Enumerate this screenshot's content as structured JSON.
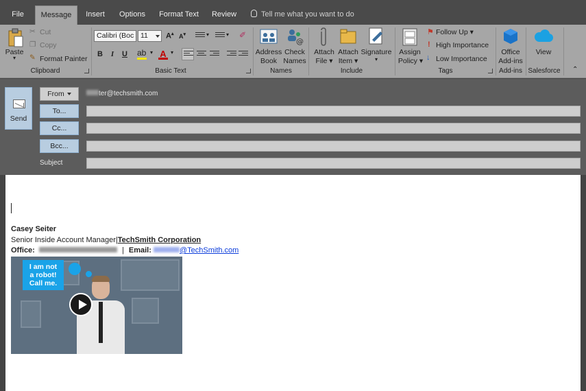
{
  "tabs": [
    "File",
    "Message",
    "Insert",
    "Options",
    "Format Text",
    "Review"
  ],
  "active_tab": "Message",
  "tell_me": "Tell me what you want to do",
  "ribbon": {
    "clipboard": {
      "paste": "Paste",
      "cut": "Cut",
      "copy": "Copy",
      "format_painter": "Format Painter",
      "label": "Clipboard"
    },
    "basic_text": {
      "font": "Calibri (Boc",
      "size": "11",
      "label": "Basic Text"
    },
    "names": {
      "address_book": [
        "Address",
        "Book"
      ],
      "check_names": [
        "Check",
        "Names"
      ],
      "label": "Names"
    },
    "include": {
      "attach_file": [
        "Attach",
        "File"
      ],
      "attach_item": [
        "Attach",
        "Item"
      ],
      "signature": "Signature",
      "label": "Include"
    },
    "tags": {
      "assign_policy": [
        "Assign",
        "Policy"
      ],
      "follow_up": "Follow Up",
      "high_importance": "High Importance",
      "low_importance": "Low Importance",
      "label": "Tags"
    },
    "addins": {
      "office_addins": [
        "Office",
        "Add-ins"
      ],
      "label": "Add-ins"
    },
    "salesforce": {
      "view": "View",
      "label": "Salesforce"
    }
  },
  "compose": {
    "send": "Send",
    "from_label": "From",
    "from_value": "ter@techsmith.com",
    "to_label": "To...",
    "cc_label": "Cc...",
    "bcc_label": "Bcc...",
    "subject_label": "Subject"
  },
  "signature": {
    "name": "Casey Seiter",
    "title": "Senior Inside Account Manager",
    "separator": "|",
    "company": "TechSmith Corporation",
    "office_label": "Office:",
    "pipe": "|",
    "email_label": "Email:",
    "email_domain": "@TechSmith.com",
    "video_bubble": [
      "I am not",
      "a robot!",
      "Call me."
    ]
  },
  "colors": {
    "tab_bar": "#4a4a4a",
    "ribbon": "#a6a6a6",
    "header_bg": "#5c5c5c",
    "field_button": "#b8cde0",
    "bubble": "#1aa3e8",
    "link": "#0b3cdb",
    "follow_up_flag": "#c0392b",
    "high_importance": "#c0392b",
    "low_importance": "#1f5fbf"
  }
}
